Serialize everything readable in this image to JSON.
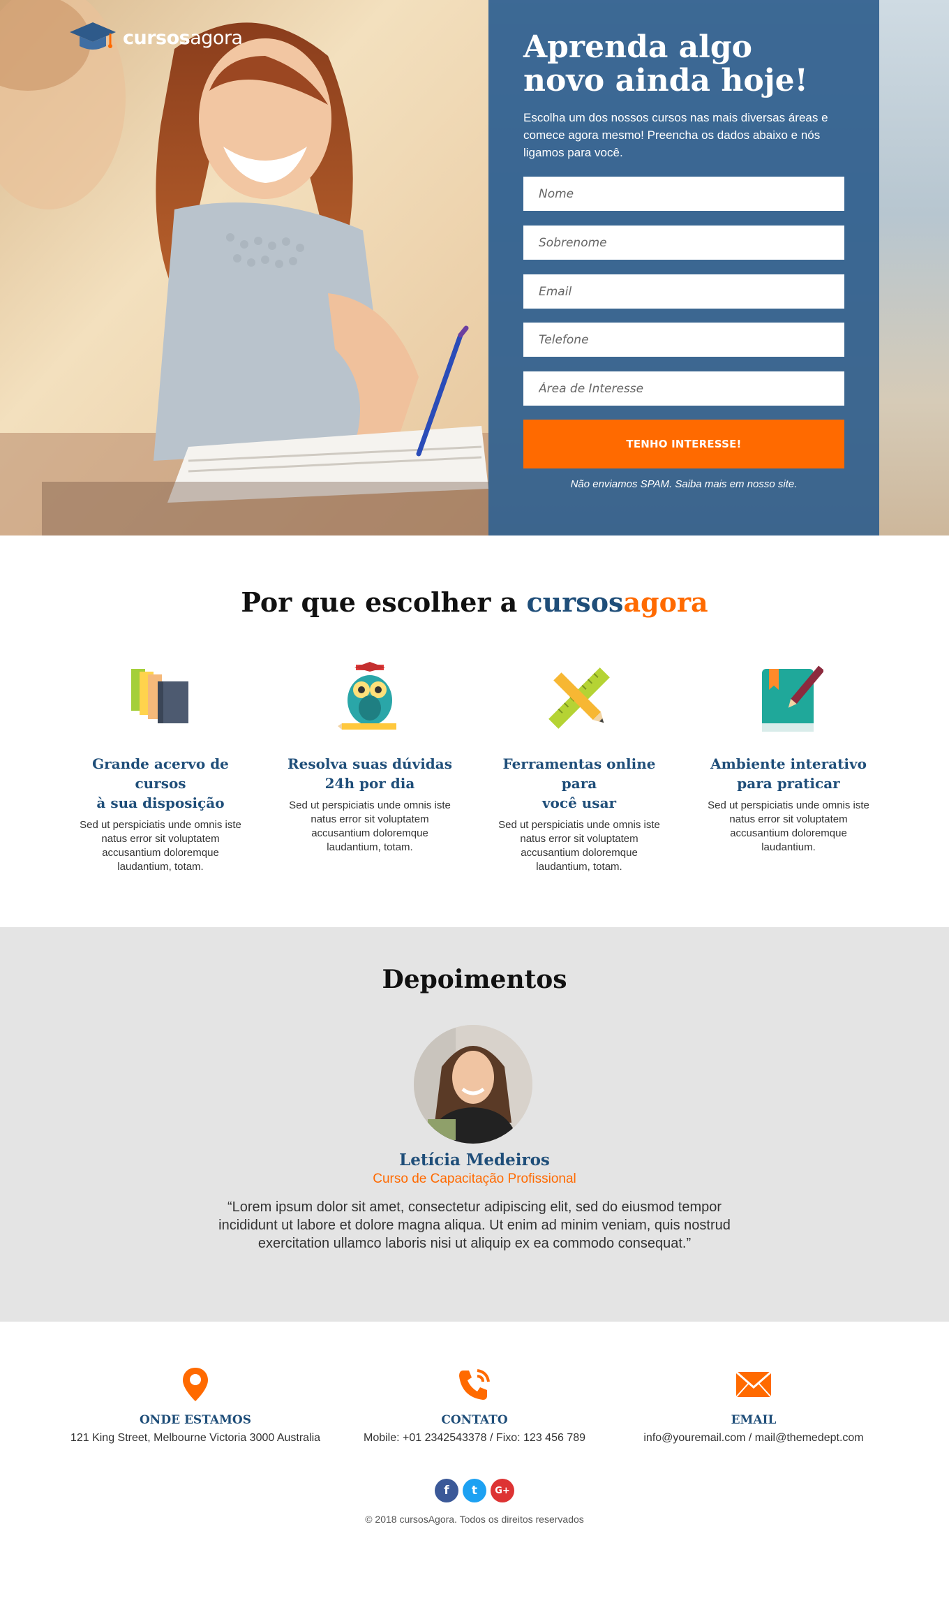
{
  "brand": {
    "name_bold": "cursos",
    "name_light": "agora"
  },
  "hero": {
    "title": "Aprenda algo\nnovo ainda hoje!",
    "subtitle": "Escolha um dos nossos cursos nas mais diversas áreas e comece agora mesmo! Preencha os dados abaixo e nós ligamos para você.",
    "fields": [
      {
        "placeholder": "Nome",
        "value": ""
      },
      {
        "placeholder": "Sobrenome",
        "value": ""
      },
      {
        "placeholder": "Email",
        "value": ""
      },
      {
        "placeholder": "Telefone",
        "value": ""
      },
      {
        "placeholder": "Área de Interesse",
        "value": ""
      }
    ],
    "cta_label": "TENHO INTERESSE!",
    "spam_note": "Não enviamos SPAM. Saiba mais em nosso site."
  },
  "why": {
    "title_prefix": "Por que escolher a ",
    "title_brand_a": "cursos",
    "title_brand_b": "agora",
    "features": [
      {
        "icon": "books-icon",
        "title": "Grande acervo de cursos\nà sua disposição",
        "text": "Sed ut perspiciatis unde omnis iste natus error sit voluptatem accusantium doloremque laudantium, totam."
      },
      {
        "icon": "owl-icon",
        "title": "Resolva suas dúvidas\n24h por dia",
        "text": "Sed ut perspiciatis unde omnis iste natus error sit voluptatem accusantium doloremque laudantium, totam."
      },
      {
        "icon": "pencil-ruler-icon",
        "title": "Ferramentas online para\nvocê usar",
        "text": "Sed ut perspiciatis unde omnis iste natus error sit voluptatem accusantium doloremque laudantium, totam."
      },
      {
        "icon": "notebook-pen-icon",
        "title": "Ambiente interativo\npara praticar",
        "text": "Sed ut perspiciatis unde omnis iste natus error sit voluptatem accusantium doloremque laudantium."
      }
    ]
  },
  "testimonials": {
    "title": "Depoimentos",
    "name": "Letícia Medeiros",
    "course": "Curso de Capacitação Profissional",
    "quote": "“Lorem ipsum dolor sit amet, consectetur adipiscing elit, sed do eiusmod tempor incididunt ut labore et dolore magna aliqua. Ut enim ad minim veniam, quis nostrud exercitation ullamco laboris nisi ut aliquip ex ea commodo consequat.”"
  },
  "contact": [
    {
      "icon": "location-pin-icon",
      "title": "ONDE ESTAMOS",
      "text": "121 King Street, Melbourne Victoria 3000 Australia"
    },
    {
      "icon": "phone-icon",
      "title": "CONTATO",
      "text": "Mobile: +01 2342543378 / Fixo: 123 456 789"
    },
    {
      "icon": "envelope-icon",
      "title": "EMAIL",
      "text": "info@youremail.com / mail@themedept.com"
    }
  ],
  "socials": [
    {
      "icon": "facebook-icon",
      "glyph": "f",
      "color": "#3b5998"
    },
    {
      "icon": "twitter-icon",
      "glyph": "t",
      "color": "#1da1f2"
    },
    {
      "icon": "google-plus-icon",
      "glyph": "G+",
      "color": "#dd3333"
    }
  ],
  "copyright": "© 2018 cursosAgora. Todos os direitos reservados",
  "colors": {
    "primary": "#1f4e79",
    "accent": "#ff6a00",
    "panel": "#2c5c8c"
  }
}
